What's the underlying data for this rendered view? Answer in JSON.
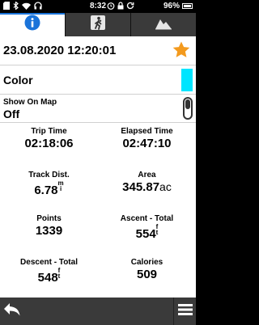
{
  "status_bar": {
    "time": "8:32",
    "battery_percent": "96%",
    "icons": [
      "sd-card-icon",
      "bluetooth-icon",
      "wifi-icon",
      "headset-icon",
      "alarm-icon",
      "lock-icon",
      "refresh-icon",
      "battery-icon"
    ]
  },
  "tabs": [
    {
      "name": "info-tab",
      "icon": "info-icon",
      "active": true
    },
    {
      "name": "activity-tab",
      "icon": "hiker-icon",
      "active": false
    },
    {
      "name": "elevation-tab",
      "icon": "elevation-profile-icon",
      "active": false
    }
  ],
  "track": {
    "date": "23.08.2020 12:20:01",
    "favorite": true,
    "color_label": "Color",
    "color_value": "#00e5ff",
    "show_on_map_label": "Show On Map",
    "show_on_map_value": "Off"
  },
  "stats": [
    {
      "label": "Trip Time",
      "value": "02:18:06",
      "unit": ""
    },
    {
      "label": "Elapsed Time",
      "value": "02:47:10",
      "unit": ""
    },
    {
      "label": "Track Dist.",
      "value": "6.78",
      "unit_top": "m",
      "unit_bottom": "i"
    },
    {
      "label": "Area",
      "value": "345.87",
      "unit": "ac"
    },
    {
      "label": "Points",
      "value": "1339",
      "unit": ""
    },
    {
      "label": "Ascent - Total",
      "value": "554",
      "unit_top": "f",
      "unit_bottom": "t"
    },
    {
      "label": "Descent - Total",
      "value": "548",
      "unit_top": "f",
      "unit_bottom": "t"
    },
    {
      "label": "Calories",
      "value": "509",
      "unit": ""
    }
  ],
  "colors": {
    "accent_blue": "#1a73d9",
    "star_orange": "#f39a1e",
    "bar_gray": "#3a3a3a"
  }
}
